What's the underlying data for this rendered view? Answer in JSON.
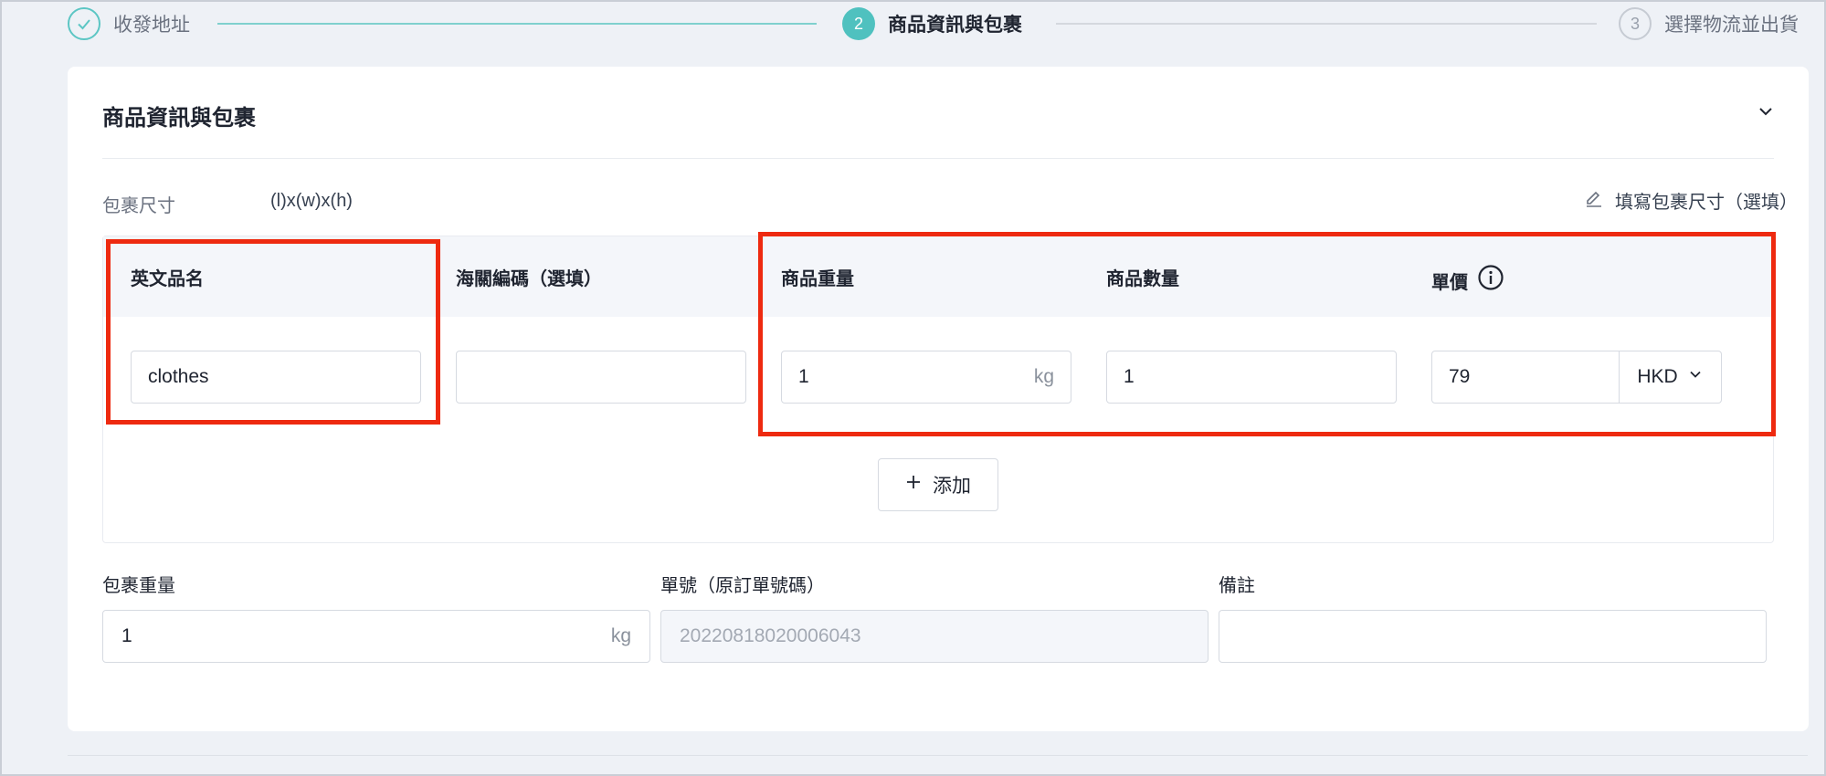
{
  "stepper": {
    "steps": [
      {
        "label": "收發地址",
        "state": "completed"
      },
      {
        "number": "2",
        "label": "商品資訊與包裹",
        "state": "active"
      },
      {
        "number": "3",
        "label": "選擇物流並出貨",
        "state": "pending"
      }
    ]
  },
  "card": {
    "title": "商品資訊與包裹",
    "collapse_icon": "chevron-down-icon"
  },
  "dimensions": {
    "label": "包裹尺寸",
    "value": "(l)x(w)x(h)",
    "edit_label": "填寫包裹尺寸（選填）",
    "edit_icon": "pencil-icon"
  },
  "items_table": {
    "headers": {
      "english_name": "英文品名",
      "hs_code": "海關編碼（選填）",
      "weight": "商品重量",
      "quantity": "商品數量",
      "unit_price": "單價"
    },
    "row": {
      "english_name": "clothes",
      "hs_code": "",
      "weight": "1",
      "weight_unit": "kg",
      "quantity": "1",
      "unit_price": "79",
      "currency": "HKD"
    },
    "add_label": "添加"
  },
  "package": {
    "weight_label": "包裹重量",
    "weight_value": "1",
    "weight_unit": "kg",
    "order_label": "單號（原訂單號碼）",
    "order_value": "20220818020006043",
    "remark_label": "備註",
    "remark_value": ""
  },
  "colors": {
    "accent": "#4fc1bf",
    "highlight": "#ee2a10"
  }
}
